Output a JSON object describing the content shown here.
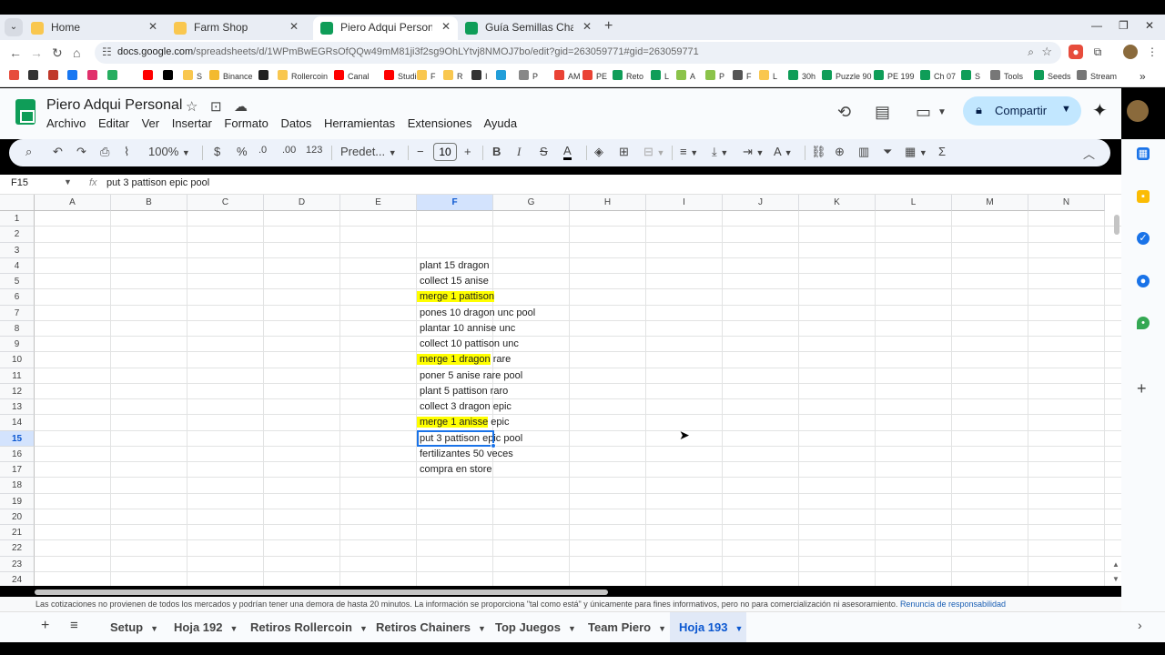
{
  "browser": {
    "tabs": [
      {
        "title": "Home",
        "color": "#f9c74f",
        "active": false
      },
      {
        "title": "Farm Shop",
        "color": "#f9c74f",
        "active": false
      },
      {
        "title": "Piero Adqui Personal - Hojas de cálculo",
        "color": "#0f9d58",
        "active": true
      },
      {
        "title": "Guía Semillas Chainers by Piero",
        "color": "#0f9d58",
        "active": false
      }
    ],
    "url_host": "docs.google.com",
    "url_path": "/spreadsheets/d/1WPmBwEGRsOfQQw49mM81ji3f2sg9OhLYtvj8NMOJ7bo/edit?gid=263059771#gid=263059771",
    "bookmarks": [
      {
        "label": "",
        "color": "#e74c3c"
      },
      {
        "label": "",
        "color": "#333333"
      },
      {
        "label": "",
        "color": "#c0392b"
      },
      {
        "label": "",
        "color": "#1877f2"
      },
      {
        "label": "",
        "color": "#e1306c"
      },
      {
        "label": "",
        "color": "#27ae60"
      },
      {
        "label": "",
        "color": "#ff0000"
      },
      {
        "label": "",
        "color": "#000000"
      },
      {
        "label": "S",
        "color": "#f9c74f"
      },
      {
        "label": "Binance",
        "color": "#f3ba2f"
      },
      {
        "label": "",
        "color": "#222222"
      },
      {
        "label": "Rollercoin",
        "color": "#f9c74f"
      },
      {
        "label": "Canal",
        "color": "#ff0000"
      },
      {
        "label": "Studio",
        "color": "#ff0000"
      },
      {
        "label": "F",
        "color": "#f9c74f"
      },
      {
        "label": "R",
        "color": "#f9c74f"
      },
      {
        "label": "I",
        "color": "#333333"
      },
      {
        "label": "",
        "color": "#229ed9"
      },
      {
        "label": "P",
        "color": "#888888"
      },
      {
        "label": "AM",
        "color": "#ea4335"
      },
      {
        "label": "PE",
        "color": "#ea4335"
      },
      {
        "label": "Reto",
        "color": "#0f9d58"
      },
      {
        "label": "L",
        "color": "#0f9d58"
      },
      {
        "label": "A",
        "color": "#8bc34a"
      },
      {
        "label": "P",
        "color": "#8bc34a"
      },
      {
        "label": "F",
        "color": "#555555"
      },
      {
        "label": "L",
        "color": "#f9c74f"
      },
      {
        "label": "30h",
        "color": "#0f9d58"
      },
      {
        "label": "Puzzle 90",
        "color": "#0f9d58"
      },
      {
        "label": "PE 199",
        "color": "#0f9d58"
      },
      {
        "label": "Ch 07",
        "color": "#0f9d58"
      },
      {
        "label": "S",
        "color": "#0f9d58"
      },
      {
        "label": "Tools",
        "color": "#777777"
      },
      {
        "label": "Seeds",
        "color": "#0f9d58"
      },
      {
        "label": "Stream",
        "color": "#777777"
      }
    ]
  },
  "sheets": {
    "title": "Piero Adqui Personal",
    "menu": [
      "Archivo",
      "Editar",
      "Ver",
      "Insertar",
      "Formato",
      "Datos",
      "Herramientas",
      "Extensiones",
      "Ayuda"
    ],
    "share_label": "Compartir",
    "toolbar": {
      "zoom": "100%",
      "currency": "$",
      "percent": "%",
      "dec_less": ".0",
      "dec_more": ".00",
      "number_format": "123",
      "font": "Predet...",
      "font_size": "10"
    },
    "name_box": "F15",
    "fx": "fx",
    "formula": "put 3 pattison epic pool",
    "columns": [
      "A",
      "B",
      "C",
      "D",
      "E",
      "F",
      "G",
      "H",
      "I",
      "J",
      "K",
      "L",
      "M",
      "N"
    ],
    "selected_column": "F",
    "rows": [
      "1",
      "2",
      "3",
      "4",
      "5",
      "6",
      "7",
      "8",
      "9",
      "10",
      "11",
      "12",
      "13",
      "14",
      "15",
      "16",
      "17",
      "18",
      "19",
      "20",
      "21",
      "22",
      "23",
      "24"
    ],
    "selected_row": "15",
    "cells": [
      {
        "row": 4,
        "text": "plant 15 dragon",
        "highlight": ""
      },
      {
        "row": 5,
        "text": "collect 15 anise",
        "highlight": ""
      },
      {
        "row": 6,
        "text": "merge 1 pattison",
        "highlight": "merge 1 pattison"
      },
      {
        "row": 7,
        "text": "pones 10 dragon unc pool",
        "highlight": ""
      },
      {
        "row": 8,
        "text": "plantar 10 annise unc",
        "highlight": ""
      },
      {
        "row": 9,
        "text": "collect 10 pattison unc",
        "highlight": ""
      },
      {
        "row": 10,
        "text": "merge 1 dragon rare",
        "highlight": "merge 1 dragon"
      },
      {
        "row": 11,
        "text": "poner 5 anise rare pool",
        "highlight": ""
      },
      {
        "row": 12,
        "text": "plant 5 pattison raro",
        "highlight": ""
      },
      {
        "row": 13,
        "text": "collect 3 dragon epic",
        "highlight": ""
      },
      {
        "row": 14,
        "text": "merge 1 anisse epic",
        "highlight": "merge 1 anisse"
      },
      {
        "row": 15,
        "text": "put 3 pattison epic pool",
        "highlight": ""
      },
      {
        "row": 16,
        "text": "fertilizantes 50 veces",
        "highlight": ""
      },
      {
        "row": 17,
        "text": "compra en store",
        "highlight": ""
      }
    ],
    "disclaimer": "Las cotizaciones no provienen de todos los mercados y podrían tener una demora de hasta 20 minutos. La información se proporciona \"tal como está\" y únicamente para fines informativos, pero no para comercialización ni asesoramiento.",
    "disclaimer_link": "Renuncia de responsabilidad",
    "sheet_tabs": [
      "Setup",
      "Hoja 192",
      "Retiros Rollercoin",
      "Retiros Chainers",
      "Top Juegos",
      "Team Piero",
      "Hoja 193"
    ],
    "active_sheet": "Hoja 193"
  },
  "colors": {
    "highlight": "#ffff00",
    "selection": "#1a73e8",
    "share_bg": "#c2e7ff",
    "sheets_green": "#0f9d58"
  }
}
